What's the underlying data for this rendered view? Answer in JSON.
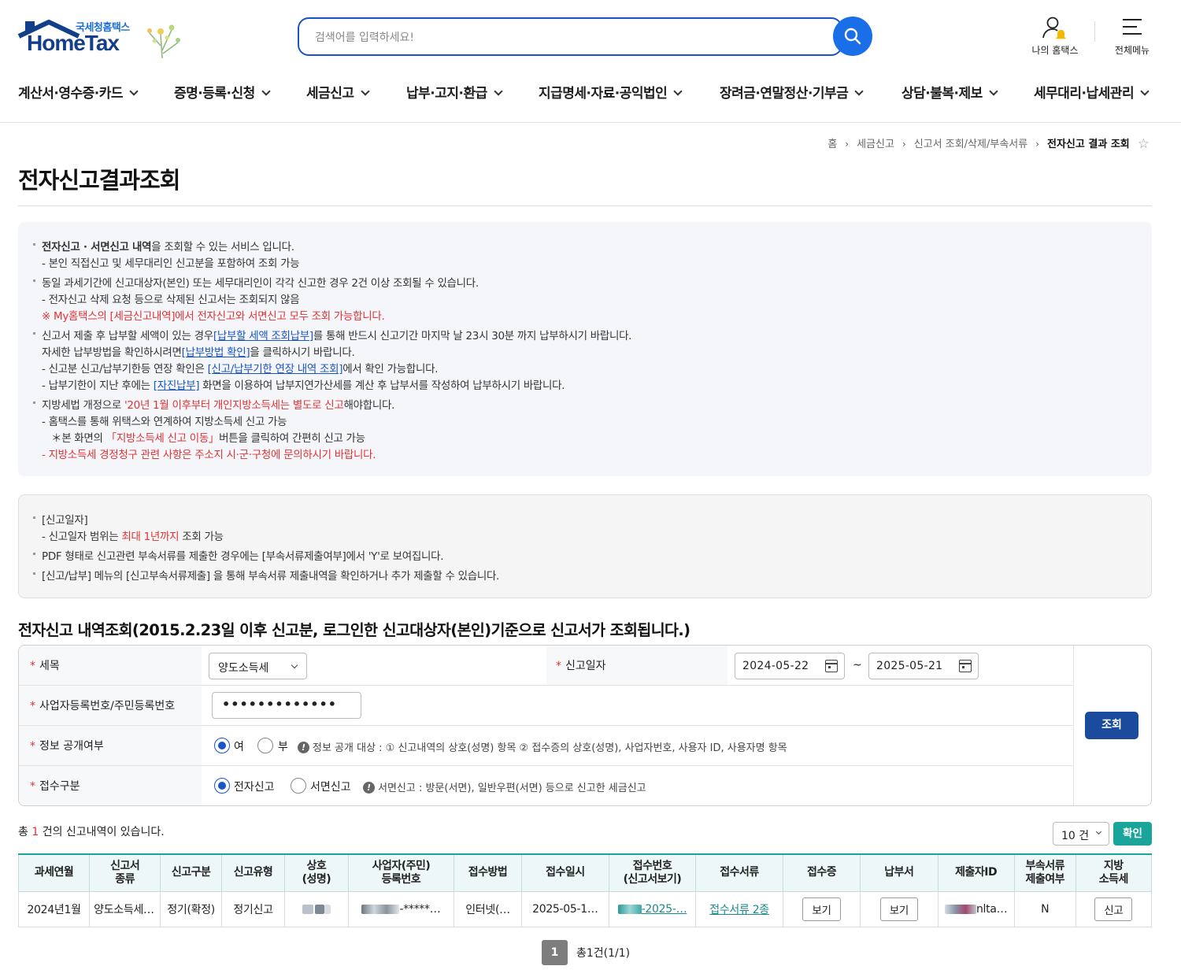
{
  "header": {
    "logo_small": "국세청홈택스",
    "logo_big": "HomeTax",
    "search_placeholder": "검색어를 입력하세요!",
    "my_home": "나의 홈택스",
    "all_menu": "전체메뉴"
  },
  "gnb": [
    "계산서·영수증·카드",
    "증명·등록·신청",
    "세금신고",
    "납부·고지·환급",
    "지급명세·자료·공익법인",
    "장려금·연말정산·기부금",
    "상담·불복·제보",
    "세무대리·납세관리"
  ],
  "breadcrumb": [
    "홈",
    "세금신고",
    "신고서 조회/삭제/부속서류",
    "전자신고 결과 조회"
  ],
  "page_title": "전자신고결과조회",
  "info1": {
    "l1_bold": "전자신고 · 서면신고 내역",
    "l1_rest": "을 조회할 수 있는 서비스 입니다.",
    "l2": "- 본인 직접신고 및 세무대리인 신고분을 포함하여 조회 가능",
    "l3": "동일 과세기간에 신고대상자(본인) 또는 세무대리인이 각각 신고한 경우 2건 이상 조회될 수 있습니다.",
    "l4": "- 전자신고 삭제 요청 등으로 삭제된 신고서는 조회되지 않음",
    "l5": "※ My홈택스의 [세금신고내역]에서 전자신고와 서면신고 모두 조회 가능합니다.",
    "l6a": "신고서 제출 후 납부할 세액이 있는 경우",
    "l6link": "[납부할 세액 조회납부]",
    "l6b": "를 통해 반드시 신고기간 마지막 날 23시 30분 까지 납부하시기 바랍니다.",
    "l7a": "자세한 납부방법을 확인하시려면",
    "l7link": "[납부방법 확인]",
    "l7b": "을 클릭하시기 바랍니다.",
    "l8a": "- 신고분 신고/납부기한등 연장 확인은 ",
    "l8link": "[신고/납부기한 연장 내역 조회]",
    "l8b": "에서 확인 가능합니다.",
    "l9a": "- 납부기한이 지난 후에는 ",
    "l9link": "[자진납부]",
    "l9b": " 화면을 이용하여 납부지연가산세를 계산 후 납부서를 작성하여 납부하시기 바랍니다.",
    "l10a": "지방세법 개정으로 ",
    "l10red": "'20년 1월 이후부터 개인지방소득세는 별도로 신고",
    "l10b": "해야합니다.",
    "l11": "- 홈택스를 통해 위택스와 연계하여 지방소득세 신고 가능",
    "l12a": "＊본 화면의 ",
    "l12red": "「지방소득세 신고 이동」",
    "l12b": "버튼을 클릭하여 간편히 신고 가능",
    "l13": "- 지방소득세 경정청구 관련 사항은 주소지 시·군·구청에 문의하시기 바랍니다."
  },
  "info2": {
    "l1": "[신고일자]",
    "l2a": "- 신고일자 범위는 ",
    "l2red": "최대 1년까지",
    "l2b": " 조회 가능",
    "l3": "PDF 형태로 신고관련 부속서류를 제출한 경우에는 [부속서류제출여부]에서 'Y'로 보여집니다.",
    "l4": "[신고/납부] 메뉴의 [신고부속서류제출] 을 통해 부속서류 제출내역을 확인하거나 추가 제출할 수 있습니다."
  },
  "subtitle": "전자신고 내역조회(2015.2.23일 이후 신고분, 로그인한  신고대상자(본인)기준으로  신고서가 조회됩니다.)",
  "form": {
    "tax_label": "세목",
    "tax_value": "양도소득세",
    "date_label": "신고일자",
    "date_from": "2024-05-22",
    "date_sep": "~",
    "date_to": "2025-05-21",
    "id_label": "사업자등록번호/주민등록번호",
    "id_value": "•••••••••••••",
    "disclose_label": "정보 공개여부",
    "disclose_yes": "여",
    "disclose_no": "부",
    "disclose_note": "정보 공개 대상 : ① 신고내역의 상호(성명) 항목 ② 접수증의 상호(성명), 사업자번호, 사용자 ID, 사용자명 항목",
    "recv_label": "접수구분",
    "recv_e": "전자신고",
    "recv_paper": "서면신고",
    "recv_note": "서면신고 : 방문(서면), 일반우편(서면) 등으로 신고한 세금신고",
    "search_btn": "조회"
  },
  "result": {
    "count_pre": "총 ",
    "count_num": "1",
    "count_post": " 건의 신고내역이 있습니다.",
    "page_size": "10 건",
    "ok_btn": "확인"
  },
  "table": {
    "headers": [
      "과세연월",
      "신고서\n종류",
      "신고구분",
      "신고유형",
      "상호\n(성명)",
      "사업자(주민)\n등록번호",
      "접수방법",
      "접수일시",
      "접수번호\n(신고서보기)",
      "접수서류",
      "접수증",
      "납부서",
      "제출자ID",
      "부속서류\n제출여부",
      "지방\n소득세"
    ],
    "row": {
      "period": "2024년1월",
      "kind": "양도소득세 …",
      "gubun": "정기(확정)",
      "type": "정기신고",
      "id_tail": "-*****…",
      "method": "인터넷(…",
      "datetime": "2025-05-1…",
      "recv_no": "-2025-…",
      "docs": "접수서류 2종",
      "receipt_btn": "보기",
      "pay_btn": "보기",
      "submitter_tail": "nlta…",
      "attach": "N",
      "local_btn": "신고"
    }
  },
  "pager": {
    "current": "1",
    "summary": "총1건(1/1)"
  }
}
